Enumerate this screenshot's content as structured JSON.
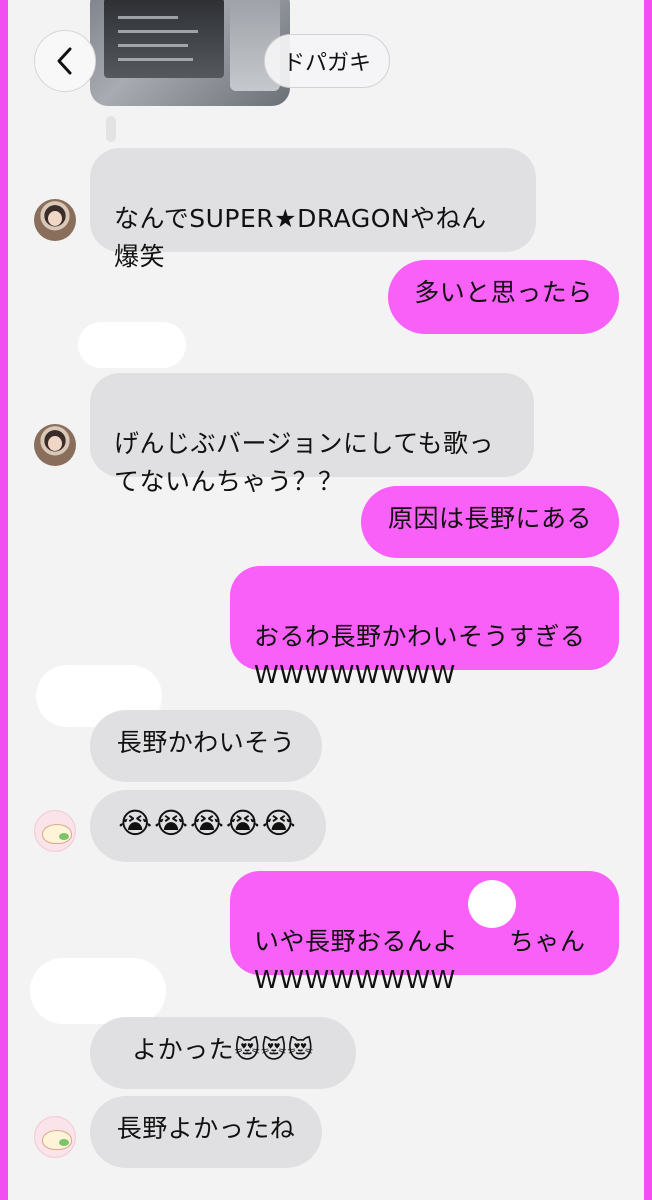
{
  "header": {
    "back_label": "‹",
    "title": "ドパガキ"
  },
  "messages": [
    {
      "side": "in",
      "text": "なんでSUPER★DRAGONやねん\n爆笑",
      "avatar": "person"
    },
    {
      "side": "out",
      "text": "多いと思ったら"
    },
    {
      "side": "in",
      "text": "げんじぶバージョンにしても歌っ\nてないんちゃう？？",
      "avatar": "person"
    },
    {
      "side": "out",
      "text": "原因は長野にある"
    },
    {
      "side": "out",
      "text": "おるわ長野かわいそうすぎる\nWWWWWWWW"
    },
    {
      "side": "in",
      "text": "長野かわいそう"
    },
    {
      "side": "in",
      "text": "😭😭😭😭😭",
      "avatar": "character"
    },
    {
      "side": "out",
      "text": "いや長野おるんよ　　ちゃん\nWWWWWWWW"
    },
    {
      "side": "in",
      "text": "よかった😻😻😻"
    },
    {
      "side": "in",
      "text": "長野よかったね",
      "avatar": "character"
    }
  ],
  "colors": {
    "outgoing_bubble": "#f860f8",
    "incoming_bubble": "#e0e0e2",
    "frame": "#f24ff2",
    "background": "#f3f3f4"
  },
  "icons": {
    "back": "chevron-left-icon"
  }
}
